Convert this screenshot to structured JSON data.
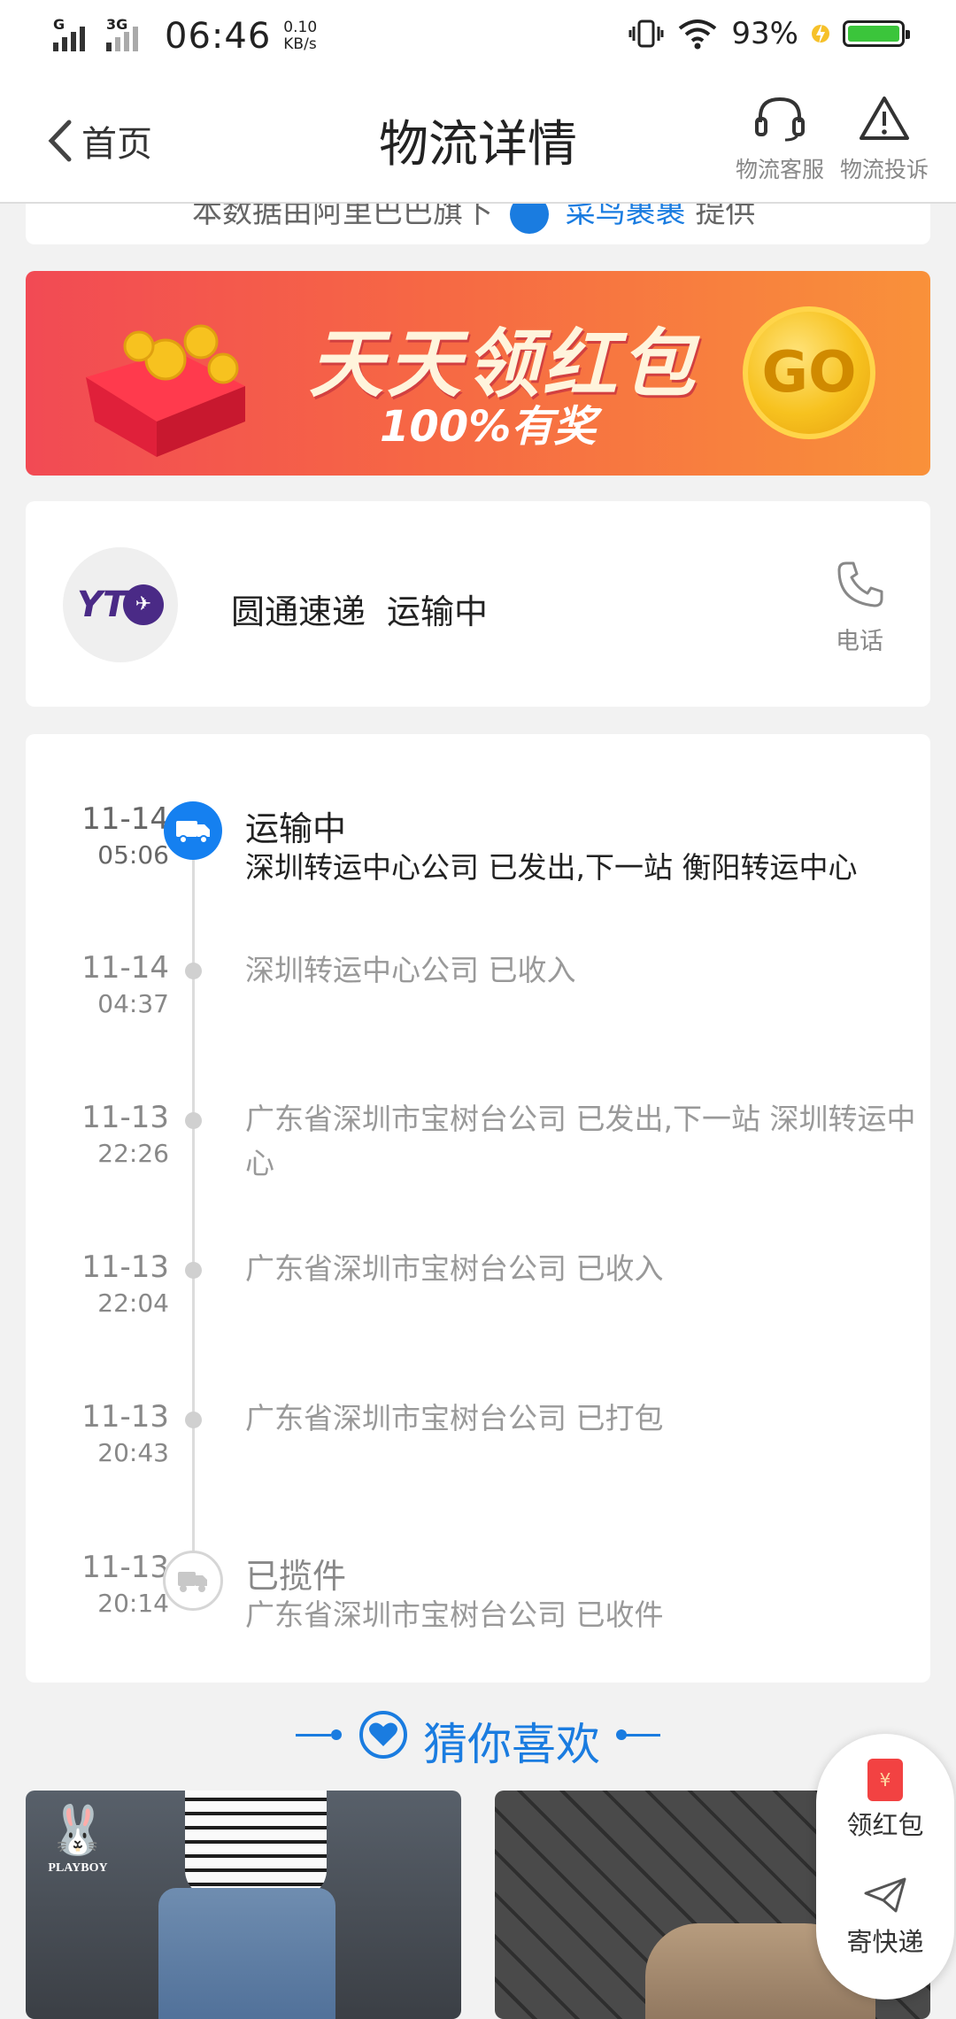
{
  "status_bar": {
    "signal1_label": "G",
    "signal2_label": "3G",
    "time": "06:46",
    "net_speed_value": "0.10",
    "net_speed_unit": "KB/s",
    "battery_pct": "93%"
  },
  "header": {
    "back_label": "首页",
    "title": "物流详情",
    "service_label": "物流客服",
    "complain_label": "物流投诉"
  },
  "data_source": {
    "prefix": "本数据由阿里巴巴旗下",
    "brand": "菜鸟裹裹",
    "suffix": "提供"
  },
  "banner": {
    "headline": "天天领红包",
    "subline": "100%有奖",
    "go_label": "GO"
  },
  "courier": {
    "logo_text": "YT",
    "company": "圆通速递",
    "status": "运输中",
    "phone_label": "电话"
  },
  "timeline": [
    {
      "date": "11-14",
      "time": "05:06",
      "status": "运输中",
      "desc": "深圳转运中心公司 已发出,下一站 衡阳转运中心"
    },
    {
      "date": "11-14",
      "time": "04:37",
      "status": "",
      "desc": "深圳转运中心公司 已收入"
    },
    {
      "date": "11-13",
      "time": "22:26",
      "status": "",
      "desc": "广东省深圳市宝树台公司 已发出,下一站 深圳转运中心"
    },
    {
      "date": "11-13",
      "time": "22:04",
      "status": "",
      "desc": "广东省深圳市宝树台公司 已收入"
    },
    {
      "date": "11-13",
      "time": "20:43",
      "status": "",
      "desc": "广东省深圳市宝树台公司 已打包"
    },
    {
      "date": "11-13",
      "time": "20:14",
      "status": "已揽件",
      "desc": "广东省深圳市宝树台公司 已收件"
    }
  ],
  "recommend": {
    "title": "猜你喜欢",
    "products": [
      {
        "brand": "PLAYBOY"
      },
      {
        "brand": ""
      }
    ]
  },
  "floating": {
    "red_packet_label": "领红包",
    "envelope_glyph": "¥",
    "send_express_label": "寄快递"
  },
  "colors": {
    "accent": "#1580f0",
    "battery": "#3bc53b",
    "text_primary": "#222222",
    "text_secondary": "#999999"
  }
}
